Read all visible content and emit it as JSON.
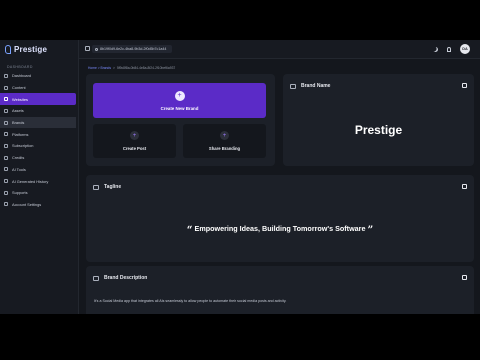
{
  "app": {
    "name": "Prestige"
  },
  "sidebar": {
    "section_label": "DASHBOARD",
    "items": [
      {
        "label": "Dashboard",
        "icon": "home-icon"
      },
      {
        "label": "Content",
        "icon": "content-icon"
      },
      {
        "label": "Websites",
        "icon": "globe-icon"
      },
      {
        "label": "Assets",
        "icon": "asset-icon"
      },
      {
        "label": "Brands",
        "icon": "brand-icon"
      },
      {
        "label": "Platforms",
        "icon": "platform-icon"
      },
      {
        "label": "Subscription",
        "icon": "card-icon"
      },
      {
        "label": "Credits",
        "icon": "coin-icon"
      },
      {
        "label": "AI Tools",
        "icon": "sparkle-icon"
      },
      {
        "label": "AI Generated History",
        "icon": "history-icon"
      },
      {
        "label": "Supports",
        "icon": "support-icon"
      },
      {
        "label": "Account Settings",
        "icon": "gear-icon"
      }
    ]
  },
  "topbar": {
    "search_value": "8b19f0d9-6e2c-4ba8-9b3d-2f0d5b7c1a44",
    "avatar_initials": "DA"
  },
  "breadcrumb": {
    "root": "Home > Brands",
    "current": "5f9c8f8a-0b84-4e8a-8f24-2f10bef6a937"
  },
  "actions": {
    "create_new_brand": "Create New Brand",
    "create_post": "Create Post",
    "share_branding": "Share Branding"
  },
  "brand": {
    "section_title": "Brand Name",
    "name": "Prestige"
  },
  "tagline": {
    "section_title": "Tagline",
    "text": "Empowering Ideas, Building Tomorrow's Software"
  },
  "description": {
    "section_title": "Brand Description",
    "text": "It's a Social Media app that integrates all AIs seamlessly to allow people to automate their social media posts and activity."
  },
  "colors": {
    "accent": "#5b2bc7",
    "background": "#14171d",
    "card": "#1c2028"
  }
}
